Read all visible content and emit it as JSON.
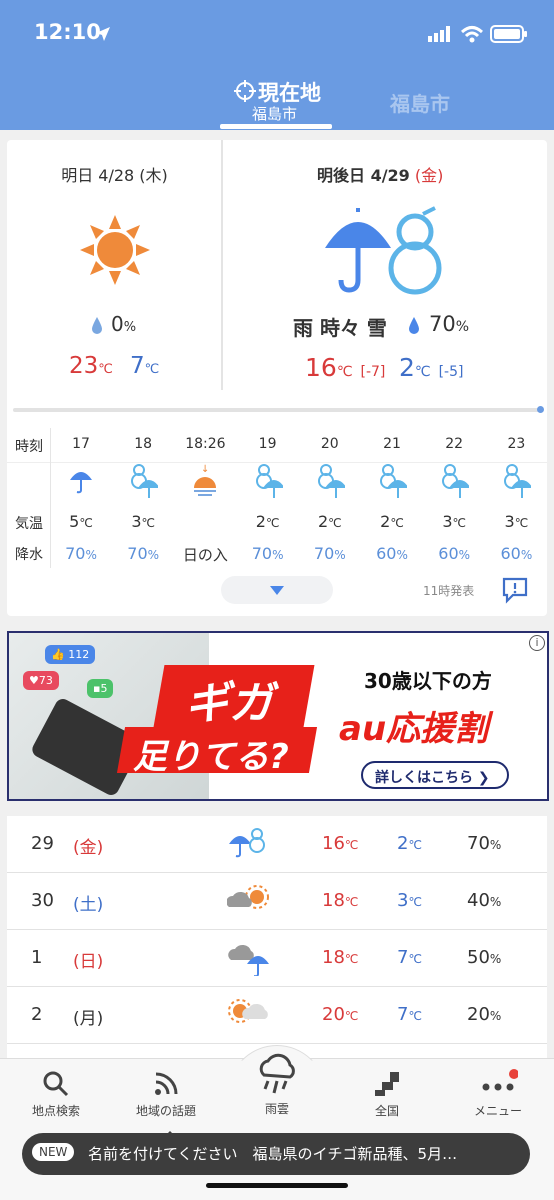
{
  "status": {
    "time": "12:10"
  },
  "tabs": {
    "current": "現在地",
    "current_sub": "福島市",
    "other": "福島市"
  },
  "tomorrow": {
    "date": "明日 4/28 (木)",
    "precip": "0",
    "precip_unit": "%",
    "high": "23",
    "low": "7",
    "unit": "℃"
  },
  "dayafter": {
    "date": "明後日 4/29",
    "dow": "(金)",
    "condition": "雨 時々 雪",
    "precip": "70",
    "precip_unit": "%",
    "high": "16",
    "high_diff": "[-7]",
    "low": "2",
    "low_diff": "[-5]",
    "unit": "℃"
  },
  "hourly": {
    "label_time": "時刻",
    "label_temp": "気温",
    "label_precip": "降水",
    "hours": [
      {
        "time": "17",
        "temp": "5",
        "unit": "℃",
        "precip": "70%",
        "icon": "rain"
      },
      {
        "time": "18",
        "temp": "3",
        "unit": "℃",
        "precip": "70%",
        "icon": "rain-snow"
      },
      {
        "time": "18:26",
        "label": "日の入",
        "icon": "sunset"
      },
      {
        "time": "19",
        "temp": "2",
        "unit": "℃",
        "precip": "70%",
        "icon": "rain-snow"
      },
      {
        "time": "20",
        "temp": "2",
        "unit": "℃",
        "precip": "70%",
        "icon": "rain-snow"
      },
      {
        "time": "21",
        "temp": "2",
        "unit": "℃",
        "precip": "60%",
        "icon": "rain-snow"
      },
      {
        "time": "22",
        "temp": "3",
        "unit": "℃",
        "precip": "60%",
        "icon": "rain-snow"
      },
      {
        "time": "23",
        "temp": "3",
        "unit": "℃",
        "precip": "60%",
        "icon": "rain-snow"
      }
    ],
    "issued": "11時発表"
  },
  "ad": {
    "likes": "112",
    "hearts": "73",
    "comments": "5",
    "headline1": "ギガ",
    "headline2": "足りてる?",
    "target": "30歳以下の方",
    "brand": "au応援割",
    "cta": "詳しくはこちら"
  },
  "weekly": [
    {
      "day": "29",
      "dow": "(金)",
      "dow_color": "#d83a3a",
      "high": "16",
      "low": "2",
      "unit": "℃",
      "precip": "70",
      "precip_unit": "%",
      "icon": "umbrella-snow"
    },
    {
      "day": "30",
      "dow": "(土)",
      "dow_color": "#3f6fc8",
      "high": "18",
      "low": "3",
      "unit": "℃",
      "precip": "40",
      "precip_unit": "%",
      "icon": "cloud-sun"
    },
    {
      "day": "1",
      "dow": "(日)",
      "dow_color": "#d83a3a",
      "high": "18",
      "low": "7",
      "unit": "℃",
      "precip": "50",
      "precip_unit": "%",
      "icon": "cloud-rain"
    },
    {
      "day": "2",
      "dow": "(月)",
      "dow_color": "#333333",
      "high": "20",
      "low": "7",
      "unit": "℃",
      "precip": "20",
      "precip_unit": "%",
      "icon": "sun-cloud"
    }
  ],
  "tabbar": {
    "search": "地点検索",
    "topics": "地域の話題",
    "rain": "雨雲",
    "nation": "全国",
    "menu": "メニュー"
  },
  "news": {
    "badge": "NEW",
    "text": "名前を付けてください　福島県のイチゴ新品種、5月…"
  },
  "colors": {
    "header": "#6a9be2",
    "red": "#d83a3a",
    "blue": "#3f6fc8",
    "orange": "#ef8a3a"
  }
}
